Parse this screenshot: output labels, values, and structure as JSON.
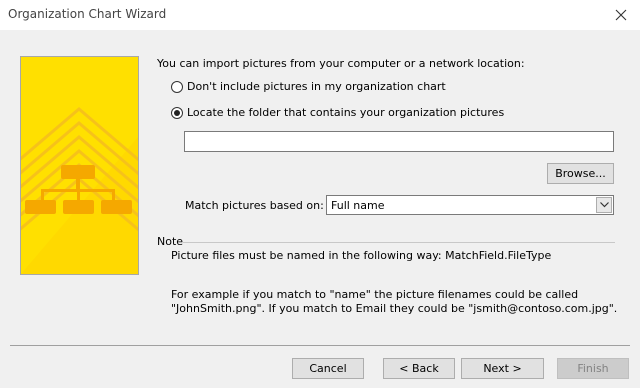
{
  "window": {
    "title": "Organization Chart Wizard"
  },
  "content": {
    "instruction": "You can import pictures from your computer or a network location:",
    "radio_options": [
      {
        "label": "Don't include pictures in my organization chart",
        "selected": false
      },
      {
        "label": "Locate the folder that contains your organization pictures",
        "selected": true
      }
    ],
    "folder_path": "",
    "browse_label": "Browse...",
    "match_label": "Match pictures based on:",
    "match_value": "Full name",
    "note_heading": "Note",
    "note_text": "Picture files must be named in the following way: MatchField.FileType",
    "example_line1": "For example if you match to \"name\" the picture filenames could be called",
    "example_line2": "\"JohnSmith.png\". If you match to Email they could be \"jsmith@contoso.com.jpg\"."
  },
  "buttons": {
    "cancel": "Cancel",
    "back": "< Back",
    "next": "Next >",
    "finish": "Finish"
  },
  "icons": {
    "close": "close-icon",
    "dropdown": "chevron-down-icon",
    "banner": "org-chart-illustration"
  },
  "colors": {
    "banner_yellow": "#ffe000",
    "banner_orange": "#f5a800"
  }
}
